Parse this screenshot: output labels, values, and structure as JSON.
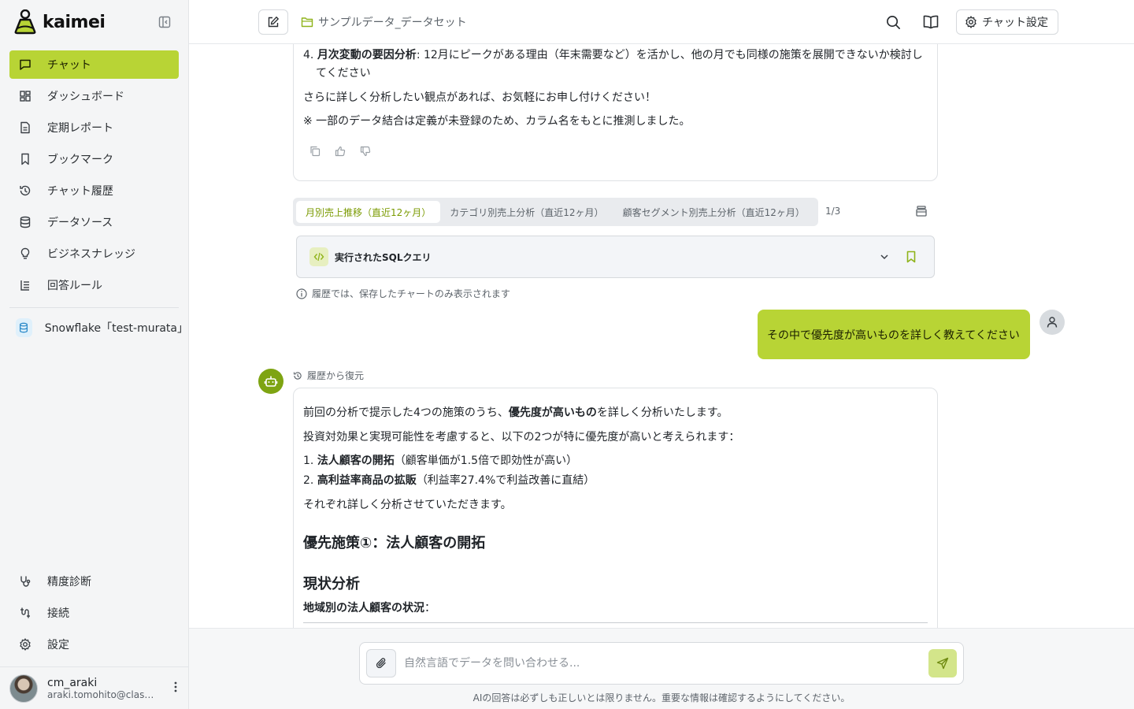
{
  "app": {
    "brand": "kaimei"
  },
  "sidebar": {
    "items": [
      {
        "label": "チャット",
        "icon": "chat-icon",
        "active": true
      },
      {
        "label": "ダッシュボード",
        "icon": "dashboard-icon"
      },
      {
        "label": "定期レポート",
        "icon": "report-icon"
      },
      {
        "label": "ブックマーク",
        "icon": "bookmark-icon"
      },
      {
        "label": "チャット履歴",
        "icon": "history-icon"
      },
      {
        "label": "データソース",
        "icon": "database-icon"
      },
      {
        "label": "ビジネスナレッジ",
        "icon": "lightbulb-icon"
      },
      {
        "label": "回答ルール",
        "icon": "rules-icon"
      }
    ],
    "datasource": {
      "label": "Snowflake「test-murata」"
    },
    "bottom": [
      {
        "label": "精度診断",
        "icon": "stethoscope-icon"
      },
      {
        "label": "接続",
        "icon": "connection-icon"
      },
      {
        "label": "設定",
        "icon": "gear-icon"
      }
    ],
    "user": {
      "name": "cm_araki",
      "email": "araki.tomohito@class..."
    }
  },
  "header": {
    "breadcrumb": "サンプルデータ_データセット",
    "settings_label": "チャット設定"
  },
  "message1": {
    "item4_prefix": "4. ",
    "item4_bold": "月次変動の要因分析",
    "item4_rest": ": 12月にピークがある理由（年末需要など）を活かし、他の月でも同様の施策を展開できないか検討してください",
    "line2": "さらに詳しく分析したい観点があれば、お気軽にお申し付けください！",
    "line3": "※ 一部のデータ結合は定義が未登録のため、カラム名をもとに推測しました。"
  },
  "chart_tabs": {
    "tabs": [
      "月別売上推移（直近12ヶ月）",
      "カテゴリ別売上分析（直近12ヶ月）",
      "顧客セグメント別売上分析（直近12ヶ月）"
    ],
    "pager": "1/3",
    "sql_label": "実行されたSQLクエリ",
    "history_note": "履歴では、保存したチャートのみ表示されます"
  },
  "user_message": "その中で優先度が高いものを詳しく教えてください",
  "message2": {
    "restored_label": "履歴から復元",
    "p1_a": "前回の分析で提示した4つの施策のうち、",
    "p1_b": "優先度が高いもの",
    "p1_c": "を詳しく分析いたします。",
    "p2": "投資対効果と実現可能性を考慮すると、以下の2つが特に優先度が高いと考えられます：",
    "li1_num": "1. ",
    "li1_bold": "法人顧客の開拓",
    "li1_rest": "（顧客単価が1.5倍で即効性が高い）",
    "li2_num": "2. ",
    "li2_bold": "高利益率商品の拡販",
    "li2_rest": "（利益率27.4%で利益改善に直結）",
    "p3": "それぞれ詳しく分析させていただきます。",
    "h_policy": "優先施策①：法人顧客の開拓",
    "h_status": "現状分析",
    "sub_bold": "地域別の法人顧客の状況",
    "sub_rest": "："
  },
  "composer": {
    "placeholder": "自然言語でデータを問い合わせる...",
    "disclaimer": "AIの回答は必ずしも正しいとは限りません。重要な情報は確認するようにしてください。"
  },
  "colors": {
    "accent": "#b8d435",
    "accent_text": "#7a9a00",
    "bot": "#7ea412"
  }
}
